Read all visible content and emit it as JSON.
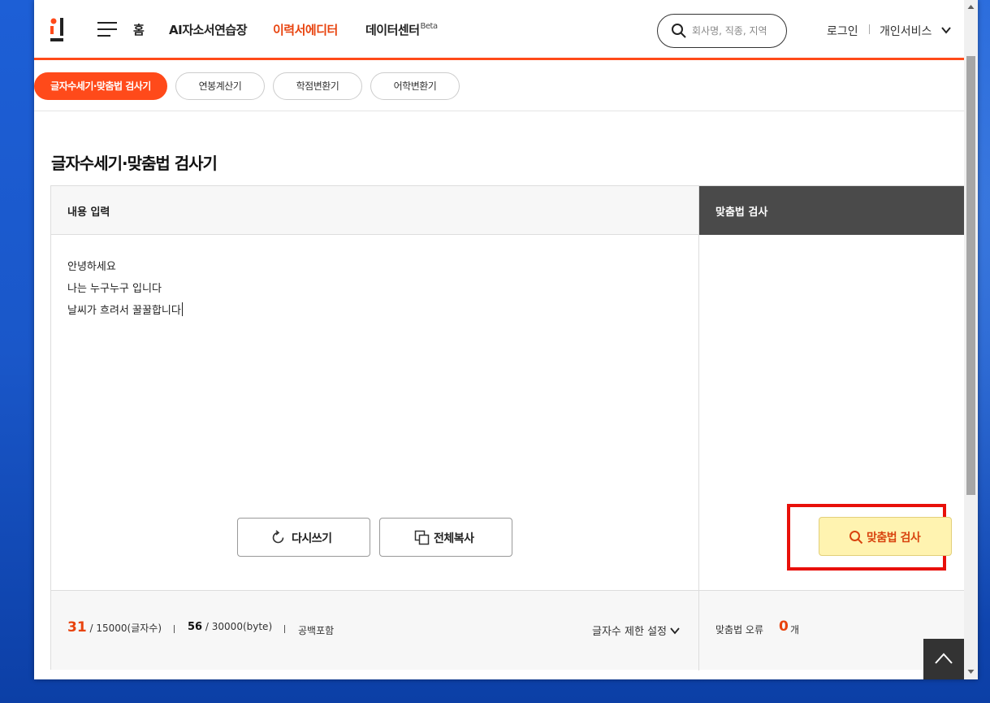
{
  "header": {
    "logo": "logo",
    "nav": [
      {
        "label": "홈"
      },
      {
        "label": "AI자소서연습장"
      },
      {
        "label": "이력서에디터"
      },
      {
        "label": "데이터센터",
        "badge": "Beta"
      }
    ],
    "search_placeholder": "회사명, 직종, 지역",
    "login": "로그인",
    "personal_service": "개인서비스"
  },
  "tabs": [
    {
      "label": "글자수세기·맞춤법 검사기",
      "active": true
    },
    {
      "label": "연봉계산기"
    },
    {
      "label": "학점변환기"
    },
    {
      "label": "어학변환기"
    }
  ],
  "page_title": "글자수세기·맞춤법 검사기",
  "editor": {
    "input_header": "내용 입력",
    "result_header": "맞춤법 검사",
    "lines": [
      "안녕하세요",
      "나는 누구누구 입니다",
      "날씨가 흐려서 꿀꿀합니다"
    ],
    "reset_button": "다시쓰기",
    "copy_button": "전체복사",
    "check_button": "맞춤법 검사"
  },
  "stats": {
    "char_count": "31",
    "char_limit": "/ 15000(글자수)",
    "byte_count": "56",
    "byte_limit": "/ 30000(byte)",
    "space_mode": "공백포함",
    "limit_setting": "글자수 제한 설정",
    "error_label": "맞춤법 오류",
    "error_count": "0",
    "error_unit": "개"
  },
  "colors": {
    "accent": "#ff4a1a",
    "highlight_border": "#e8100a",
    "check_button_bg": "#fff3b0"
  },
  "icons": [
    "menu-icon",
    "search-icon",
    "chevron-down-icon",
    "refresh-icon",
    "copy-icon",
    "search-icon",
    "chevron-up-icon"
  ]
}
